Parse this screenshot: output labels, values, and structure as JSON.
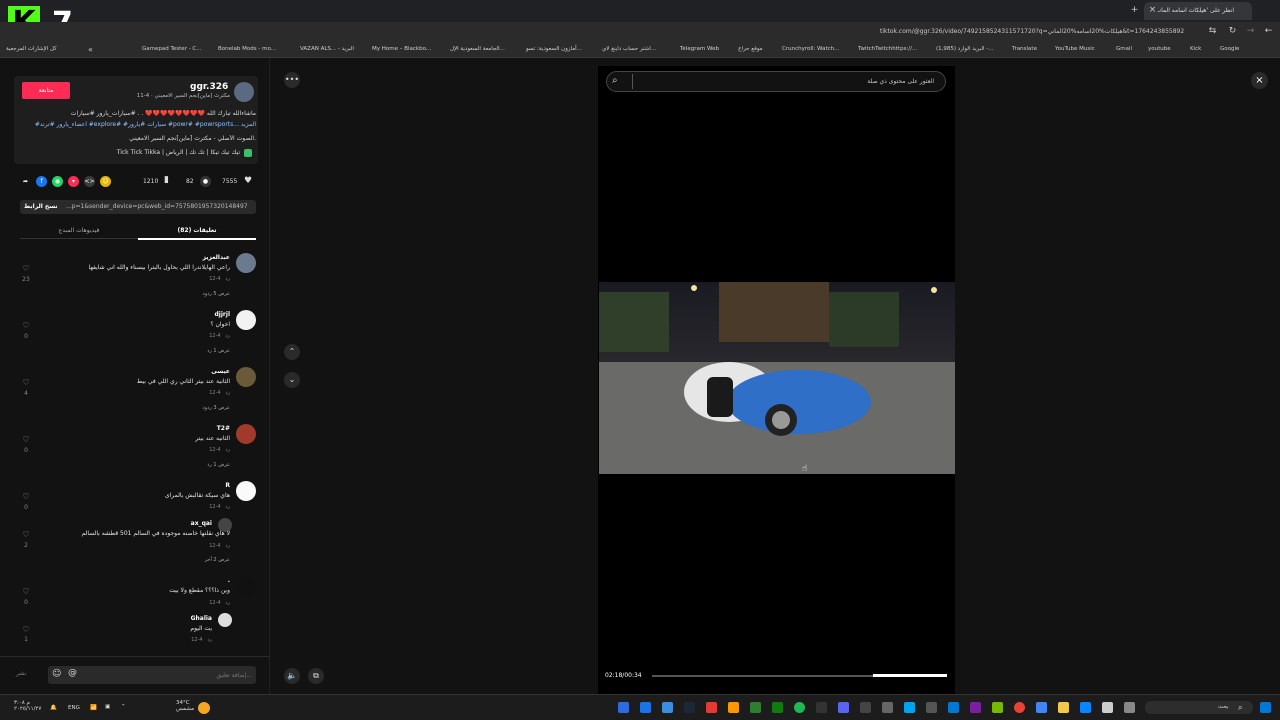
{
  "browser": {
    "tab_title": "انظر على 'هيلكات اسامه المانـ",
    "url": "tiktok.com/@ggr.326/video/7492158524311571720?q=هيلكات%20اسامه%20الماني&t=1764243855892",
    "bookmarks": [
      "كل الإشارات المرجعية",
      "Gamepad Tester - C...",
      "Bonelab Mods - mo...",
      "VAZAN ALS... - البريد",
      "My Home – Blackbo...",
      "الجامعة السعودية الإل...",
      "أمازون السعودية: تسو...",
      "اشتر حساب داينغ لاي...",
      "Telegram Web",
      "موقع حراج",
      "Crunchyroll: Watch...",
      "TwitchTwitchhttps://...",
      "(1,985) البريد الوارد -...",
      "Translate",
      "YouTube Music",
      "Gmail",
      "youtube",
      "Kick",
      "Google"
    ]
  },
  "post": {
    "follow_label": "متابعة",
    "username": "ggr.326",
    "subline": "مكترث [ماين]نجم السير الامعيني · 4-11",
    "description_line1": "ماشاءالله تبارك الله ❤️❤️❤️❤️❤️❤️❤️❤️ . . #سيارات_يارور #سيارات",
    "description_line2": "#اعضاء_يارور #ترند #explore# #سيارات #يارور #powr# #powrsports... المزيد",
    "sound": "الصوت الأصلي - مكترث [ماين]نجم السير الامعيني.",
    "music": "Tick Tick Tikka | تيك تيك تيكا | تك تك | الرياض",
    "likes": "7555",
    "comments_count": "82",
    "bookmarks_count": "1210",
    "copy_link_label": "نسخ الرابط",
    "link_text": "...p=1&sender_device=pc&web_id=7575801957320148497",
    "tab_comments": "تعليقات (82)",
    "tab_creator_videos": "فيديوهات المبدع"
  },
  "comments": [
    {
      "name": "عبدالعزيز",
      "text": "راعي الهايلاندرا اللي بحاول بالبترا بيسناء والله اني شايفها",
      "date": "4-12",
      "reply": "رد",
      "likes": "23",
      "replies": "عرض 5 ردود"
    },
    {
      "name": "djjrjl",
      "text": "اخوان ؟",
      "date": "4-12",
      "reply": "رد",
      "likes": "0",
      "replies": "عرض 1 رد"
    },
    {
      "name": "عيسى",
      "text": "الثانية عند بيتر الثاني ري اللي في بيط",
      "date": "4-12",
      "reply": "رد",
      "likes": "4",
      "replies": "عرض 3 ردود"
    },
    {
      "name": "T2#",
      "text": "الثانيه عند بيتر",
      "date": "4-12",
      "reply": "رد",
      "likes": "0",
      "replies": "عرض 1 رد"
    },
    {
      "name": "R",
      "text": "هاي سيكة تقالبش بالمراى",
      "date": "4-12",
      "reply": "رد",
      "likes": "0",
      "replies": ""
    },
    {
      "name": "ax_qai",
      "text": "لا هاي نقلتها خاصنه موجوده في السالم 501 قطشه بالسالم",
      "date": "4-12",
      "reply": "رد",
      "likes": "2",
      "replies": "عرض 2 آخر"
    },
    {
      "name": ".",
      "text": "وين ذا؟؟؟ مقطع ولا بيت",
      "date": "4-12",
      "reply": "رد",
      "likes": "0",
      "replies": ""
    },
    {
      "name": "Ghalia",
      "text": "يت اليوم",
      "date": "4-12",
      "reply": "رد",
      "likes": "1",
      "replies": ""
    }
  ],
  "composer": {
    "placeholder": "إضافة تعليق...",
    "post_label": "نشر"
  },
  "player": {
    "search_placeholder": "العثور على محتوى ذي صلة",
    "time": "02:18/00:34",
    "progress": 0.75
  },
  "taskbar": {
    "weather_temp": "34°C",
    "weather_desc": "مشمس",
    "lang": "ENG",
    "time": "م ٣:٠٨",
    "date": "٢٠٢٥/١١/٢٧",
    "search_placeholder": "بحث"
  },
  "colors": {
    "accent": "#fe2c55",
    "kick_green": "#53fc18",
    "link_blue": "#8ec2ff"
  }
}
